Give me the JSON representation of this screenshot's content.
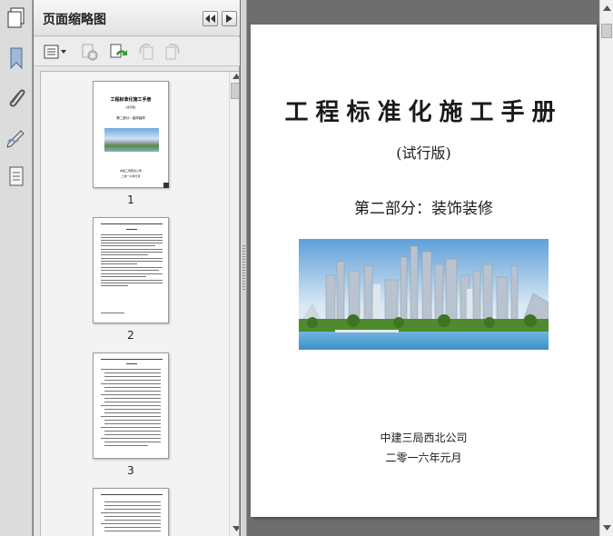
{
  "panel": {
    "title": "页面缩略图"
  },
  "thumbnails": [
    {
      "page_label": "1",
      "cover_title": "工程标准化施工手册",
      "cover_edition": "(试行版)",
      "cover_part": "第二部分：装饰装修",
      "cover_company": "中建三局西北公司",
      "cover_date": "二零一六年元月"
    },
    {
      "page_label": "2"
    },
    {
      "page_label": "3"
    },
    {
      "page_label": ""
    }
  ],
  "document": {
    "title": "工程标准化施工手册",
    "edition": "(试行版)",
    "part": "第二部分：装饰装修",
    "company": "中建三局西北公司",
    "date": "二零一六年元月"
  },
  "icons": {
    "sidebar": [
      "pages-icon",
      "bookmark-icon",
      "attachment-icon",
      "signature-icon",
      "layers-icon"
    ],
    "toolbar": [
      "options-menu-icon",
      "delete-page-icon",
      "insert-page-icon",
      "rotate-left-icon",
      "rotate-right-icon"
    ]
  }
}
